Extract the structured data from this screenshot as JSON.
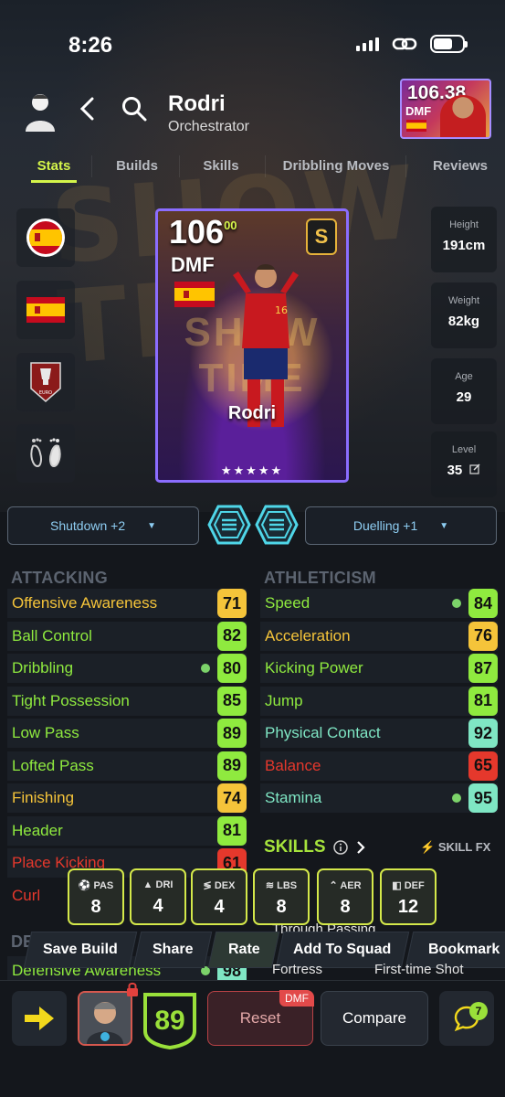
{
  "status": {
    "time": "8:26"
  },
  "header": {
    "player_name": "Rodri",
    "player_role": "Orchestrator"
  },
  "mini_card": {
    "rating": "106.38",
    "position": "DMF"
  },
  "tabs": [
    {
      "label": "Stats",
      "active": true
    },
    {
      "label": "Builds"
    },
    {
      "label": "Skills"
    },
    {
      "label": "Dribbling Moves"
    },
    {
      "label": "Reviews"
    }
  ],
  "card": {
    "rating": "106",
    "rating_sup": "00",
    "position": "DMF",
    "badge": "S",
    "name": "Rodri",
    "stars": "★★★★★",
    "shirt_number": "16"
  },
  "info": {
    "height": {
      "label": "Height",
      "value": "191cm"
    },
    "weight": {
      "label": "Weight",
      "value": "82kg"
    },
    "age": {
      "label": "Age",
      "value": "29"
    },
    "level": {
      "label": "Level",
      "value": "35"
    }
  },
  "selectors": {
    "left": "Shutdown +2",
    "right": "Duelling +1"
  },
  "attacking": {
    "title": "ATTACKING",
    "stats": [
      {
        "name": "Offensive Awareness",
        "value": "71",
        "color": "yellow"
      },
      {
        "name": "Ball Control",
        "value": "82",
        "color": "green"
      },
      {
        "name": "Dribbling",
        "value": "80",
        "color": "green",
        "dot": true
      },
      {
        "name": "Tight Possession",
        "value": "85",
        "color": "green"
      },
      {
        "name": "Low Pass",
        "value": "89",
        "color": "green"
      },
      {
        "name": "Lofted Pass",
        "value": "89",
        "color": "green"
      },
      {
        "name": "Finishing",
        "value": "74",
        "color": "yellow"
      },
      {
        "name": "Header",
        "value": "81",
        "color": "green"
      },
      {
        "name": "Place Kicking",
        "value": "61",
        "color": "red"
      },
      {
        "name": "Curl",
        "value": "",
        "color": "red"
      }
    ]
  },
  "athleticism": {
    "title": "ATHLETICISM",
    "stats": [
      {
        "name": "Speed",
        "value": "84",
        "color": "green",
        "dot": true
      },
      {
        "name": "Acceleration",
        "value": "76",
        "color": "yellow"
      },
      {
        "name": "Kicking Power",
        "value": "87",
        "color": "green"
      },
      {
        "name": "Jump",
        "value": "81",
        "color": "green"
      },
      {
        "name": "Physical Contact",
        "value": "92",
        "color": "teal"
      },
      {
        "name": "Balance",
        "value": "65",
        "color": "red"
      },
      {
        "name": "Stamina",
        "value": "95",
        "color": "teal",
        "dot": true
      }
    ]
  },
  "skills": {
    "title": "SKILLS",
    "fx": "SKILL FX",
    "partial_1": "Through Passing",
    "partial_2": "Fortress",
    "partial_3": "First-time Shot"
  },
  "defending_partial": {
    "title": "DE",
    "stat": "Defensive Awareness",
    "value": "98"
  },
  "overlay": [
    {
      "key": "PAS",
      "value": "8"
    },
    {
      "key": "DRI",
      "value": "4"
    },
    {
      "key": "DEX",
      "value": "4"
    },
    {
      "key": "LBS",
      "value": "8"
    },
    {
      "key": "AER",
      "value": "8"
    },
    {
      "key": "DEF",
      "value": "12"
    }
  ],
  "actions": [
    "Save Build",
    "Share",
    "Rate",
    "Add To Squad",
    "Bookmark"
  ],
  "bottom": {
    "rating": "89",
    "reset": "Reset",
    "reset_badge": "DMF",
    "compare": "Compare",
    "chat_count": "7"
  },
  "colors": {
    "accent": "#d4f54a",
    "green": "#8fea3f",
    "yellow": "#f5c43a",
    "teal": "#7fe6c4",
    "red": "#e5382c",
    "selector_text": "#8ecdf2"
  }
}
